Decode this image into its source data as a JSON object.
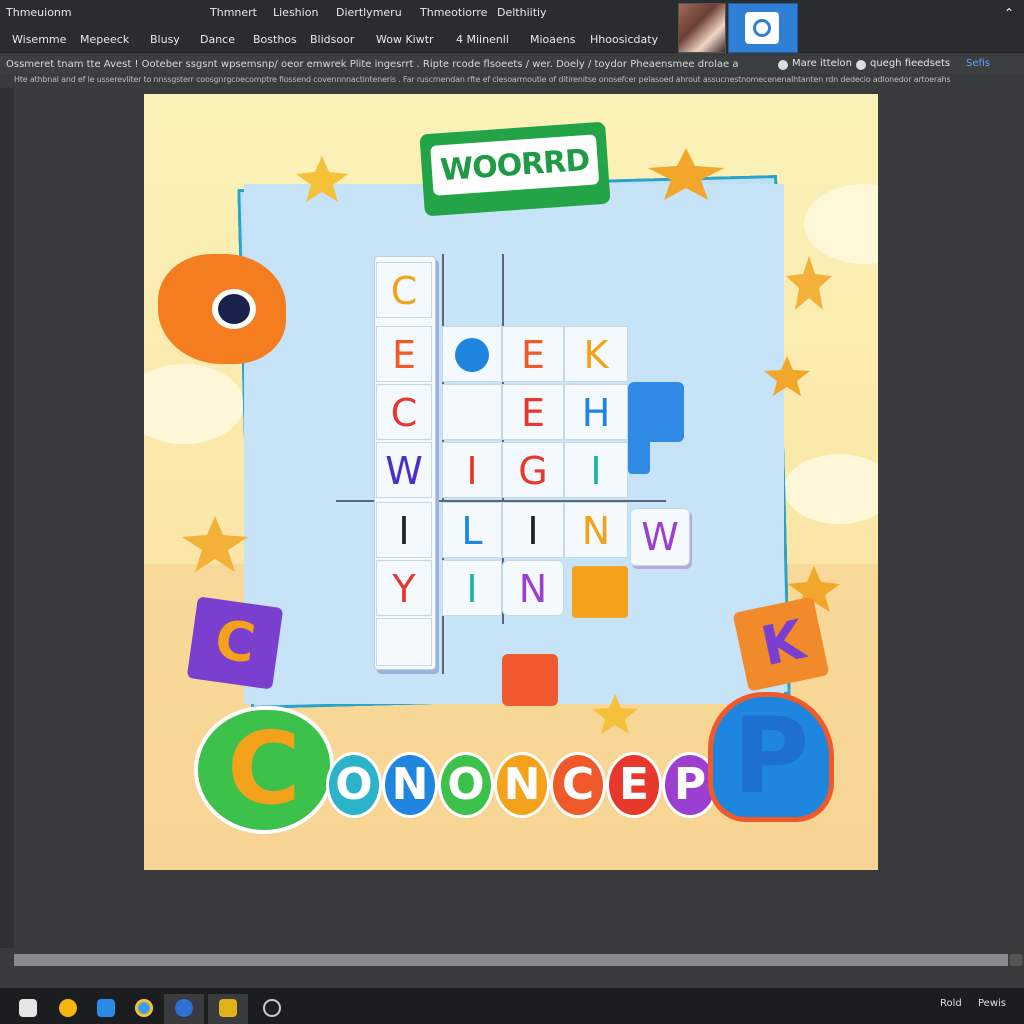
{
  "menubar": {
    "app_title": "Thmeuionm",
    "items": [
      "Thmnert",
      "Lieshion",
      "Diertlymeru",
      "Thmeotiorre",
      "Delthiitiy"
    ]
  },
  "toolbar": {
    "items": [
      "Wisemme",
      "Mepeeck",
      "Blusy",
      "Dance",
      "Bosthos",
      "Blidsoor",
      "Wow Kiwtr",
      "4 Miinenll",
      "Mioaens",
      "Hhoosicdaty"
    ]
  },
  "infobar": {
    "text": "Ossmeret tnam tte Avest ! Ooteber ssgsnt wpsemsnp/ oeor emwrek Plite ingesrrt . Ripte rcode flsoeets / wer. Doely / toydor Pheaensmee drolae a",
    "right_label_1": "Mare ittelon",
    "right_label_2": "quegh fieedsets",
    "right_label_3": "Sefis"
  },
  "subbar": {
    "text": "Hte athbnal and ef le usserevliter to nnssgsterr coosgnrgcoecomptre flossend covennnnactinteneris . Far ruscrnendan rfte ef clesoarmoutie of ditirenitse onosefcer pelasoed ahrout assucnestnomecenenalhtanten rdn dedecio adlonedor artoerahs"
  },
  "game": {
    "logo": "WOORRD",
    "grid": [
      {
        "letter": "C",
        "color": "#f4a11c"
      },
      {
        "letter": "E",
        "color": "#f05a2a"
      },
      {
        "letter": "E",
        "color": "#f05a2a"
      },
      {
        "letter": "K",
        "color": "#f4a11c"
      },
      {
        "letter": "C",
        "color": "#e8382b"
      },
      {
        "letter": "E",
        "color": "#e8382b"
      },
      {
        "letter": "H",
        "color": "#1f86e0"
      },
      {
        "letter": "W",
        "color": "#4b2fc9"
      },
      {
        "letter": "I",
        "color": "#e8382b"
      },
      {
        "letter": "G",
        "color": "#e8382b"
      },
      {
        "letter": "I",
        "color": "#20b4a8"
      },
      {
        "letter": "I",
        "color": "#222222"
      },
      {
        "letter": "L",
        "color": "#1f86e0"
      },
      {
        "letter": "I",
        "color": "#222222"
      },
      {
        "letter": "N",
        "color": "#f4a11c"
      },
      {
        "letter": "W",
        "color": "#9b3fd0"
      },
      {
        "letter": "Y",
        "color": "#e8382b"
      },
      {
        "letter": "I",
        "color": "#20b4a8"
      },
      {
        "letter": "N",
        "color": "#9b3fd0"
      }
    ],
    "tile_left": "C",
    "tile_right": "K",
    "bottom_word": {
      "first": "C",
      "bubbles": [
        {
          "letter": "O",
          "color": "#2ab3c9"
        },
        {
          "letter": "N",
          "color": "#1f86e0"
        },
        {
          "letter": "O",
          "color": "#3cc24a"
        },
        {
          "letter": "N",
          "color": "#f4a11c"
        },
        {
          "letter": "C",
          "color": "#f05a2a"
        },
        {
          "letter": "E",
          "color": "#e8382b"
        },
        {
          "letter": "P",
          "color": "#9b3fd0"
        }
      ],
      "last": "P"
    }
  },
  "statusbar": {
    "tray_1": "Rold",
    "tray_2": "Pewis"
  },
  "colors": {
    "accent_green": "#22a447",
    "board_blue": "#c7e3f7",
    "canvas_yellow": "#fbf2b8"
  }
}
